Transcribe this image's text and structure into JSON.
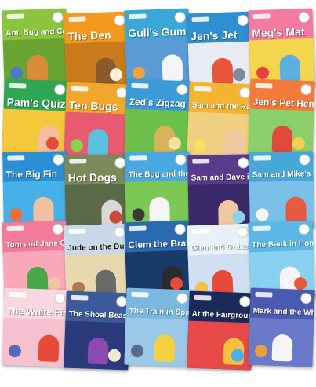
{
  "books": [
    {
      "title": "Ant, Bug and Cat",
      "bg": "#8bc43f",
      "scene": "#6aa532",
      "fig": "#d98b3a",
      "prop": "#4a7ac8",
      "dark": false
    },
    {
      "title": "The Den",
      "bg": "#f39a1e",
      "scene": "#c97a1a",
      "fig": "#8a5a2a",
      "prop": "#fff2d8",
      "dark": false
    },
    {
      "title": "Gull's Gum",
      "bg": "#3aa7d8",
      "scene": "#5b9bd5",
      "fig": "#f5f5f5",
      "prop": "#f2a23a",
      "dark": false
    },
    {
      "title": "Jen's Jet",
      "bg": "#2f8fd1",
      "scene": "#e8ecf2",
      "fig": "#e8553a",
      "prop": "#7a8aa0",
      "dark": false
    },
    {
      "title": "Meg's Mat",
      "bg": "#f47aa0",
      "scene": "#f3d64b",
      "fig": "#5bb0e0",
      "prop": "#e84040",
      "dark": false
    },
    {
      "title": "Pam's Quiz",
      "bg": "#2fa653",
      "scene": "#f5c73b",
      "fig": "#f0c0a0",
      "prop": "#e84a3a",
      "dark": false
    },
    {
      "title": "Ten Bugs",
      "bg": "#f0a72b",
      "scene": "#e85a70",
      "fig": "#5ac0e0",
      "prop": "#8bcf4a",
      "dark": false
    },
    {
      "title": "Zed's Zigzag",
      "bg": "#3b9ad8",
      "scene": "#6bbf4a",
      "fig": "#d9b35a",
      "prop": "#f3e3a0",
      "dark": false
    },
    {
      "title": "Sam and the Ram",
      "bg": "#f3b531",
      "scene": "#f0d080",
      "fig": "#f0c8a0",
      "prop": "#f8e060",
      "dark": false
    },
    {
      "title": "Jen's Pet Hen",
      "bg": "#f47a3a",
      "scene": "#8ad06a",
      "fig": "#e04a3a",
      "prop": "#f2d050",
      "dark": false
    },
    {
      "title": "The Big Fin",
      "bg": "#2b8fd8",
      "scene": "#46b0e8",
      "fig": "#f0c0a0",
      "prop": "#f36a3a",
      "dark": false
    },
    {
      "title": "Hot Dogs",
      "bg": "#7a8a5a",
      "scene": "#5a6a48",
      "fig": "#d8d8d8",
      "prop": "#c84a3a",
      "dark": false
    },
    {
      "title": "The Bug and the Pup",
      "bg": "#4aa8e0",
      "scene": "#7cc856",
      "fig": "#f5f5f5",
      "prop": "#3a3a3a",
      "dark": false
    },
    {
      "title": "Sam and Dave in the Cave",
      "bg": "#5a3a8a",
      "scene": "#3a2a6a",
      "fig": "#f0c8a0",
      "prop": "#8ad0f0",
      "dark": false
    },
    {
      "title": "Sam and Mike's Time",
      "bg": "#47a7d8",
      "scene": "#7ac0e8",
      "fig": "#e85a40",
      "prop": "#f5f5f5",
      "dark": false
    },
    {
      "title": "Tom and Jane Go Home",
      "bg": "#f27a9a",
      "scene": "#f8a8b8",
      "fig": "#4aa84a",
      "prop": "#f0c8a0",
      "dark": false
    },
    {
      "title": "Jude on the Dune",
      "bg": "#c8d8e8",
      "scene": "#e8d8b0",
      "fig": "#6a6a6a",
      "prop": "#b07a4a",
      "dark": true
    },
    {
      "title": "Clem the Brave",
      "bg": "#2a6ab0",
      "scene": "#1a3a6a",
      "fig": "#2a2a2a",
      "prop": "#e84a3a",
      "dark": false
    },
    {
      "title": "Glen and Drake's Trip",
      "bg": "#e8f0f8",
      "scene": "#d0e0f0",
      "fig": "#e84a3a",
      "prop": "#f5c040",
      "dark": false
    },
    {
      "title": "The Bank in Hong Kong",
      "bg": "#5ab8e8",
      "scene": "#88d0f0",
      "fig": "#f5f5f5",
      "prop": "#e85a3a",
      "dark": false
    },
    {
      "title": "The White Fish",
      "bg": "#f8d8e0",
      "scene": "#f5c0d0",
      "fig": "#e84a3a",
      "prop": "#5a6ab0",
      "dark": false
    },
    {
      "title": "The Shoal Beast",
      "bg": "#3a5a9a",
      "scene": "#2a3a7a",
      "fig": "#8a4ab0",
      "prop": "#f0e8d0",
      "dark": false
    },
    {
      "title": "The Train in Spain",
      "bg": "#7ab8e0",
      "scene": "#9ac8e8",
      "fig": "#f5d040",
      "prop": "#5a6a8a",
      "dark": false
    },
    {
      "title": "At the Fairgrounds",
      "bg": "#1a2a5a",
      "scene": "#e84a4a",
      "fig": "#f5c040",
      "prop": "#4ab0e8",
      "dark": false
    },
    {
      "title": "Mark and the White Stork",
      "bg": "#4a5ab0",
      "scene": "#6a7ac8",
      "fig": "#f5f5f5",
      "prop": "#e8a040",
      "dark": false
    }
  ]
}
